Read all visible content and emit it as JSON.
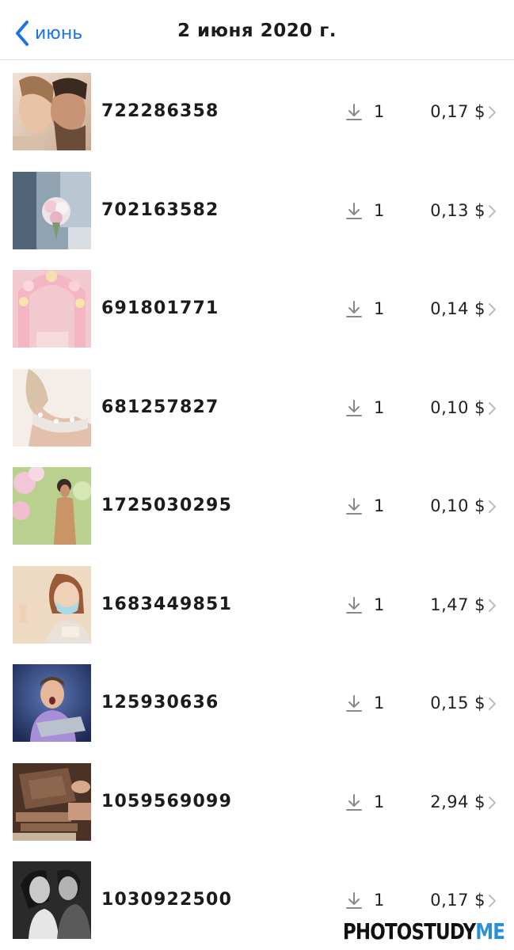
{
  "nav": {
    "back_label": "июнь",
    "title": "2 июня 2020 г."
  },
  "items": [
    {
      "id": "722286358",
      "downloads": "1",
      "price": "0,17 $",
      "thumb": "couple-closeup"
    },
    {
      "id": "702163582",
      "downloads": "1",
      "price": "0,13 $",
      "thumb": "bridal-bouquet"
    },
    {
      "id": "691801771",
      "downloads": "1",
      "price": "0,14 $",
      "thumb": "flower-arch"
    },
    {
      "id": "681257827",
      "downloads": "1",
      "price": "0,10 $",
      "thumb": "bride-shoulders"
    },
    {
      "id": "1725030295",
      "downloads": "1",
      "price": "0,10 $",
      "thumb": "woman-blossom"
    },
    {
      "id": "1683449851",
      "downloads": "1",
      "price": "1,47 $",
      "thumb": "masked-woman-cake"
    },
    {
      "id": "125930636",
      "downloads": "1",
      "price": "0,15 $",
      "thumb": "surprised-man-laptop"
    },
    {
      "id": "1059569099",
      "downloads": "1",
      "price": "2,94 $",
      "thumb": "wedding-album-box"
    },
    {
      "id": "1030922500",
      "downloads": "1",
      "price": "0,17 $",
      "thumb": "couple-bw"
    }
  ],
  "watermark": {
    "part1": "PHOTOSTUDY",
    "part2": "ME"
  },
  "colors": {
    "accent": "#1a73e8",
    "watermark_blue": "#2a8fd8"
  }
}
